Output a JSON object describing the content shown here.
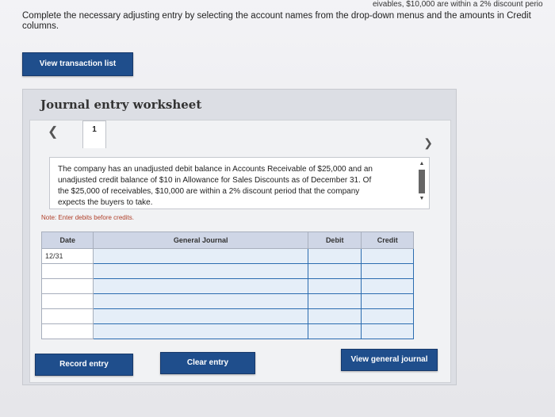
{
  "header": {
    "top_text": "eivables, $10,000 are within a 2% discount perio",
    "instructions": "Complete the necessary adjusting entry by selecting the account names from the drop-down menus and the amounts in Credit columns."
  },
  "buttons": {
    "view_transaction_list": "View transaction list",
    "record_entry": "Record entry",
    "clear_entry": "Clear entry",
    "view_general_journal": "View general journal"
  },
  "worksheet": {
    "title": "Journal entry worksheet",
    "current_tab": "1",
    "description": "The company has an unadjusted debit balance in Accounts Receivable of $25,000 and an unadjusted credit balance of $10 in Allowance for Sales Discounts as of December 31. Of the $25,000 of receivables, $10,000 are within a 2% discount period that the company expects the buyers to take.",
    "note": "Note: Enter debits before credits."
  },
  "journal": {
    "headers": [
      "Date",
      "General Journal",
      "Debit",
      "Credit"
    ],
    "rows": [
      {
        "date": "12/31",
        "account": "",
        "debit": "",
        "credit": ""
      },
      {
        "date": "",
        "account": "",
        "debit": "",
        "credit": ""
      },
      {
        "date": "",
        "account": "",
        "debit": "",
        "credit": ""
      },
      {
        "date": "",
        "account": "",
        "debit": "",
        "credit": ""
      },
      {
        "date": "",
        "account": "",
        "debit": "",
        "credit": ""
      },
      {
        "date": "",
        "account": "",
        "debit": "",
        "credit": ""
      }
    ]
  },
  "icons": {
    "prev": "chevron-left-icon",
    "next": "chevron-right-icon",
    "scroll_up": "arrow-up-icon",
    "scroll_down": "arrow-down-icon"
  }
}
